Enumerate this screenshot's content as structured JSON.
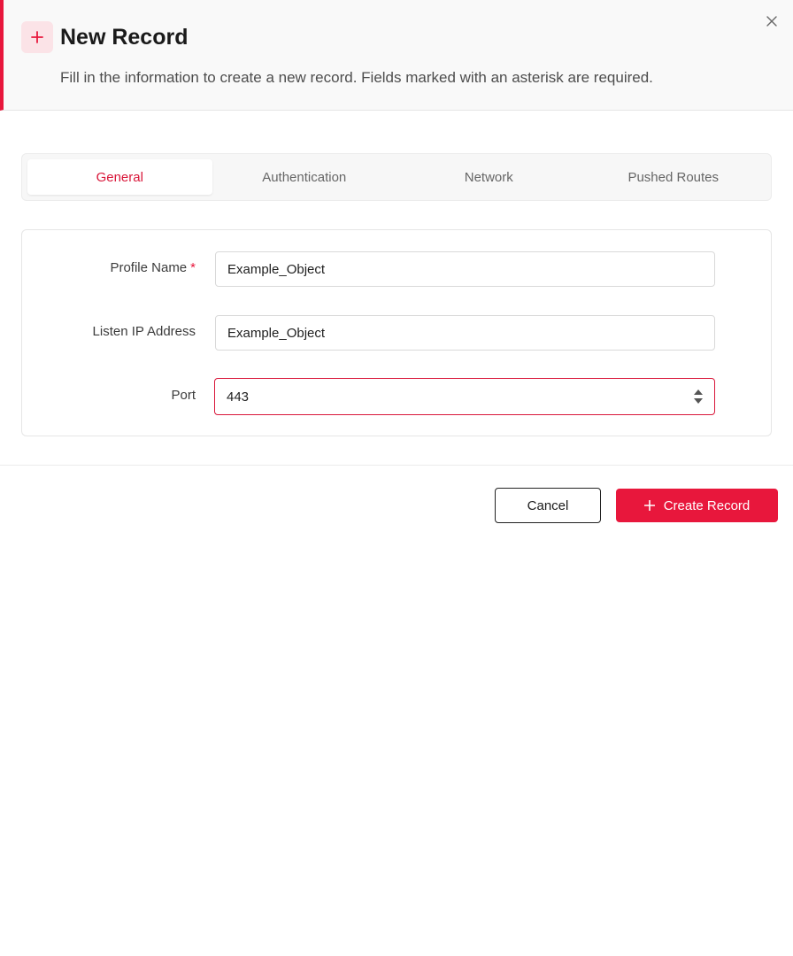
{
  "dialog": {
    "title": "New Record",
    "subtitle": "Fill in the information to create a new record. Fields marked with an asterisk are required.",
    "icon": "plus-icon",
    "close_icon": "close-icon"
  },
  "tabs": [
    {
      "label": "General",
      "active": true
    },
    {
      "label": "Authentication",
      "active": false
    },
    {
      "label": "Network",
      "active": false
    },
    {
      "label": "Pushed Routes",
      "active": false
    }
  ],
  "form": {
    "profile_name": {
      "label": "Profile Name",
      "required_mark": "*",
      "value": "Example_Object"
    },
    "listen_ip": {
      "label": "Listen IP Address",
      "value": "Example_Object"
    },
    "port": {
      "label": "Port",
      "value": "443"
    }
  },
  "footer": {
    "cancel_label": "Cancel",
    "create_label": "Create Record"
  },
  "colors": {
    "accent": "#e8173c",
    "accent_light": "#fbe3e7"
  }
}
